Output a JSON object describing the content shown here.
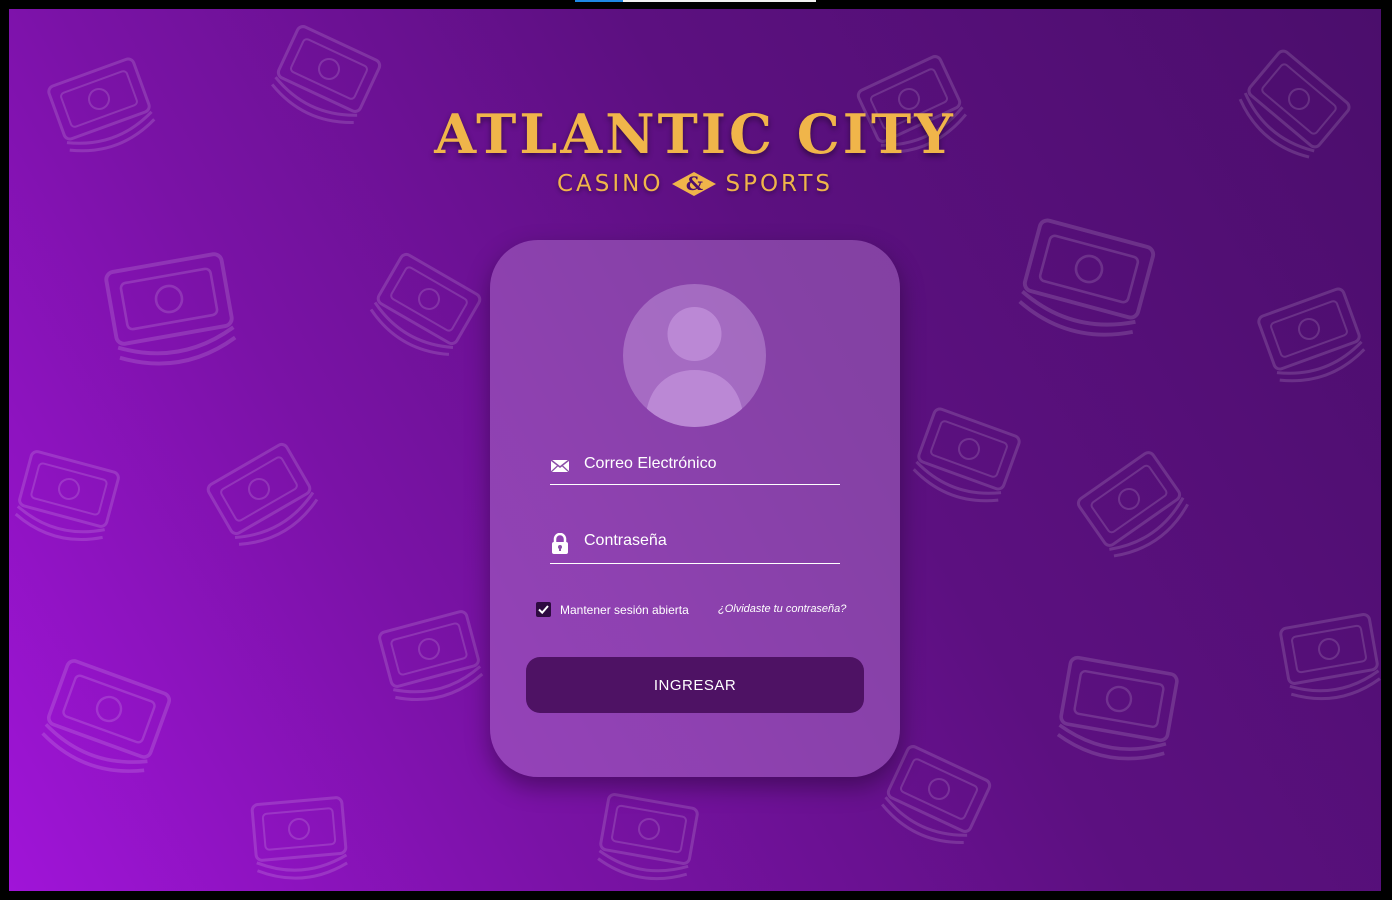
{
  "page_progress": {
    "fraction": 0.2,
    "color": "#1e88e5"
  },
  "brand": {
    "title": "ATLANTIC CITY",
    "subtitle_left": "CASINO",
    "subtitle_amp": "&",
    "subtitle_right": "SPORTS",
    "color": "#f0b54a"
  },
  "login": {
    "avatar_icon": "user-silhouette-icon",
    "email": {
      "icon": "envelope-icon",
      "placeholder": "Correo Electrónico",
      "value": ""
    },
    "password": {
      "icon": "lock-icon",
      "placeholder": "Contraseña",
      "value": ""
    },
    "remember": {
      "label": "Mantener sesión abierta",
      "checked": true
    },
    "forgot_label": "¿Olvidaste tu contraseña?",
    "submit_label": "INGRESAR"
  },
  "colors": {
    "background_start": "#a014d8",
    "background_end": "#4b0e6c",
    "button": "#4e1264"
  }
}
